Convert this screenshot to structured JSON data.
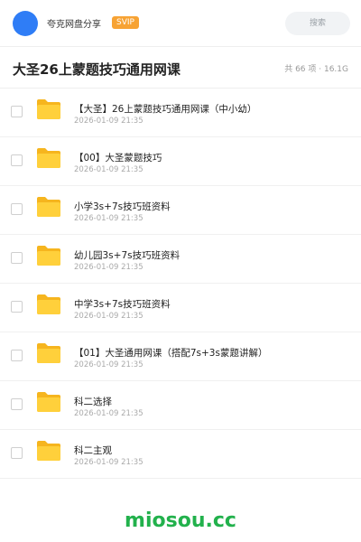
{
  "header": {
    "app_name": "夸克网盘分享",
    "badge": "SVIP",
    "search_placeholder": "搜索",
    "avatar_color": "#2f7df6",
    "badge_color": "#f7a334"
  },
  "folder": {
    "title": "大圣26上蒙题技巧通用网课",
    "summary": "共 66 项 · 16.1G"
  },
  "files": [
    {
      "name": "【大圣】26上蒙题技巧通用网课（中小幼）",
      "date": "2026-01-09 21:35",
      "icon": "folder-icon"
    },
    {
      "name": "【00】大圣蒙题技巧",
      "date": "2026-01-09 21:35",
      "icon": "folder-icon"
    },
    {
      "name": "小学3s+7s技巧班资料",
      "date": "2026-01-09 21:35",
      "icon": "folder-icon"
    },
    {
      "name": "幼儿园3s+7s技巧班资料",
      "date": "2026-01-09 21:35",
      "icon": "folder-icon"
    },
    {
      "name": "中学3s+7s技巧班资料",
      "date": "2026-01-09 21:35",
      "icon": "folder-icon"
    },
    {
      "name": "【01】大圣通用网课（搭配7s+3s蒙题讲解）",
      "date": "2026-01-09 21:35",
      "icon": "folder-icon"
    },
    {
      "name": "科二选择",
      "date": "2026-01-09 21:35",
      "icon": "folder-icon"
    },
    {
      "name": "科二主观",
      "date": "2026-01-09 21:35",
      "icon": "folder-icon"
    }
  ],
  "watermark": "miosou.cc",
  "watermark_color": "#22b14c"
}
